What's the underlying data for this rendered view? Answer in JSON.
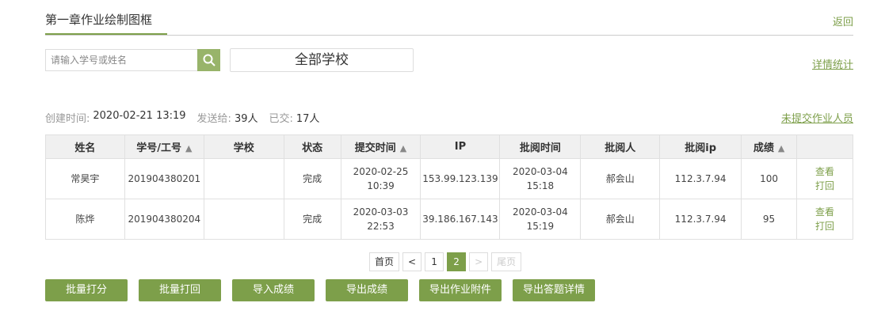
{
  "header": {
    "title": "第一章作业绘制图框",
    "back_label": "返回"
  },
  "toolbar": {
    "search_placeholder": "请输入学号或姓名",
    "school_select_value": "全部学校",
    "stats_label": "详情统计"
  },
  "info": {
    "created_label": "创建时间:",
    "created_value": "2020-02-21 13:19",
    "sent_label": "发送给:",
    "sent_value": "39人",
    "submitted_label": "已交:",
    "submitted_value": "17人",
    "unsubmitted_link": "未提交作业人员"
  },
  "table": {
    "headers": [
      "姓名",
      "学号/工号",
      "学校",
      "状态",
      "提交时间",
      "IP",
      "批阅时间",
      "批阅人",
      "批阅ip",
      "成绩",
      ""
    ],
    "rows": [
      {
        "name": "常昊宇",
        "id": "201904380201",
        "school": "",
        "status": "完成",
        "submit_date": "2020-02-25",
        "submit_time": "10:39",
        "ip": "153.99.123.139",
        "review_date": "2020-03-04",
        "review_time": "15:18",
        "reviewer": "郝会山",
        "review_ip": "112.3.7.94",
        "score": "100",
        "action_view": "查看",
        "action_return": "打回"
      },
      {
        "name": "陈烨",
        "id": "201904380204",
        "school": "",
        "status": "完成",
        "submit_date": "2020-03-03",
        "submit_time": "22:53",
        "ip": "39.186.167.143",
        "review_date": "2020-03-04",
        "review_time": "15:19",
        "reviewer": "郝会山",
        "review_ip": "112.3.7.94",
        "score": "95",
        "action_view": "查看",
        "action_return": "打回"
      }
    ]
  },
  "pagination": {
    "first": "首页",
    "prev": "<",
    "page1": "1",
    "page2": "2",
    "next": ">",
    "last": "尾页"
  },
  "actions": {
    "batch_score": "批量打分",
    "batch_return": "批量打回",
    "import_scores": "导入成绩",
    "export_scores": "导出成绩",
    "export_attachments": "导出作业附件",
    "export_answers": "导出答题详情"
  },
  "colors": {
    "accent": "#7d9f4a",
    "search_button": "#98b46a"
  }
}
